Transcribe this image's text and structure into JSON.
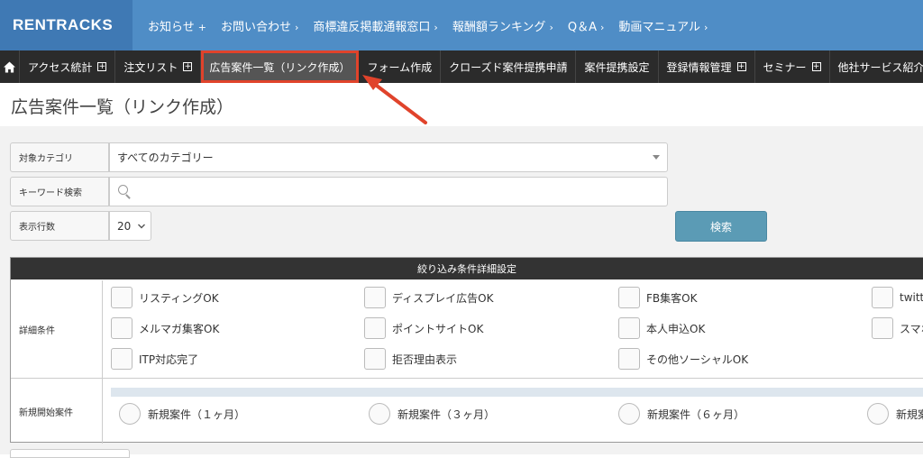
{
  "header": {
    "logo": "RENTRACKS",
    "links": [
      {
        "label": "お知らせ",
        "suffix": "+"
      },
      {
        "label": "お問い合わせ",
        "suffix": "›"
      },
      {
        "label": "商標違反掲載通報窓口",
        "suffix": "›"
      },
      {
        "label": "報酬額ランキング",
        "suffix": "›"
      },
      {
        "label": "Q＆A",
        "suffix": "›"
      },
      {
        "label": "動画マニュアル",
        "suffix": "›"
      }
    ]
  },
  "nav": {
    "home_icon": "home-icon",
    "items": [
      {
        "label": "アクセス統計",
        "expand": "+"
      },
      {
        "label": "注文リスト",
        "expand": "+"
      },
      {
        "label": "広告案件一覧（リンク作成）",
        "expand": ""
      },
      {
        "label": "フォーム作成",
        "expand": ""
      },
      {
        "label": "クローズド案件提携申請",
        "expand": ""
      },
      {
        "label": "案件提携設定",
        "expand": ""
      },
      {
        "label": "登録情報管理",
        "expand": "+"
      },
      {
        "label": "セミナー",
        "expand": "+"
      },
      {
        "label": "他社サービス紹介",
        "expand": ""
      }
    ],
    "highlight_color": "#e0432b"
  },
  "page": {
    "title": "広告案件一覧（リンク作成）"
  },
  "form": {
    "category_label": "対象カテゴリ",
    "category_value": "すべてのカテゴリー",
    "keyword_label": "キーワード検索",
    "keyword_value": "",
    "rows_label": "表示行数",
    "rows_value": "20",
    "search_button": "検索"
  },
  "filter_panel": {
    "title": "絞り込み条件詳細設定",
    "detail_label": "詳細条件",
    "checkboxes": [
      "リスティングOK",
      "ディスプレイ広告OK",
      "FB集客OK",
      "twitt",
      "メルマガ集客OK",
      "ポイントサイトOK",
      "本人申込OK",
      "スマホ",
      "ITP対応完了",
      "拒否理由表示",
      "その他ソーシャルOK"
    ],
    "new_label": "新規開始案件",
    "radios": [
      "新規案件（１ヶ月）",
      "新規案件（３ヶ月）",
      "新規案件（６ヶ月）",
      "新規案"
    ]
  }
}
